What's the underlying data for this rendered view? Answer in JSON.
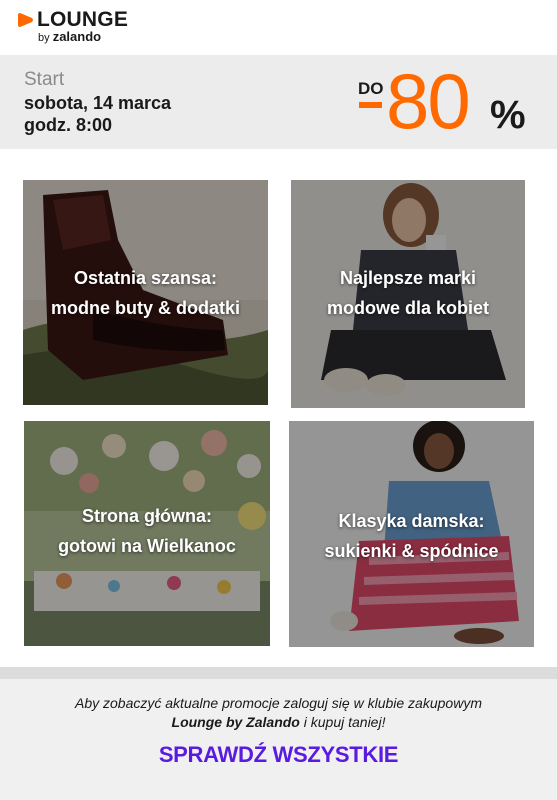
{
  "brand": {
    "logo_word": "LOUNGE",
    "logo_by": "by",
    "logo_brand": "zalando",
    "accent_color": "#ff6900"
  },
  "banner": {
    "start_label": "Start",
    "start_date": "sobota, 14 marca",
    "start_time": "godz. 8:00",
    "discount_prefix": "DO",
    "discount_value": "80",
    "discount_unit": "%"
  },
  "tiles": [
    {
      "line1": "Ostatnia szansa:",
      "line2": "modne buty & dodatki"
    },
    {
      "line1": "Najlepsze marki",
      "line2": "modowe dla kobiet"
    },
    {
      "line1": "Strona główna:",
      "line2": "gotowi na Wielkanoc"
    },
    {
      "line1": "Klasyka damska:",
      "line2": "sukienki & spódnice"
    }
  ],
  "footer": {
    "note_part1": "Aby zobaczyć aktualne promocje zaloguj się w klubie zakupowym",
    "note_brand": "Lounge by Zalando",
    "note_part2": " i kupuj taniej!",
    "cta_label": "SPRAWDŹ WSZYSTKIE",
    "cta_color": "#5a1be0"
  }
}
